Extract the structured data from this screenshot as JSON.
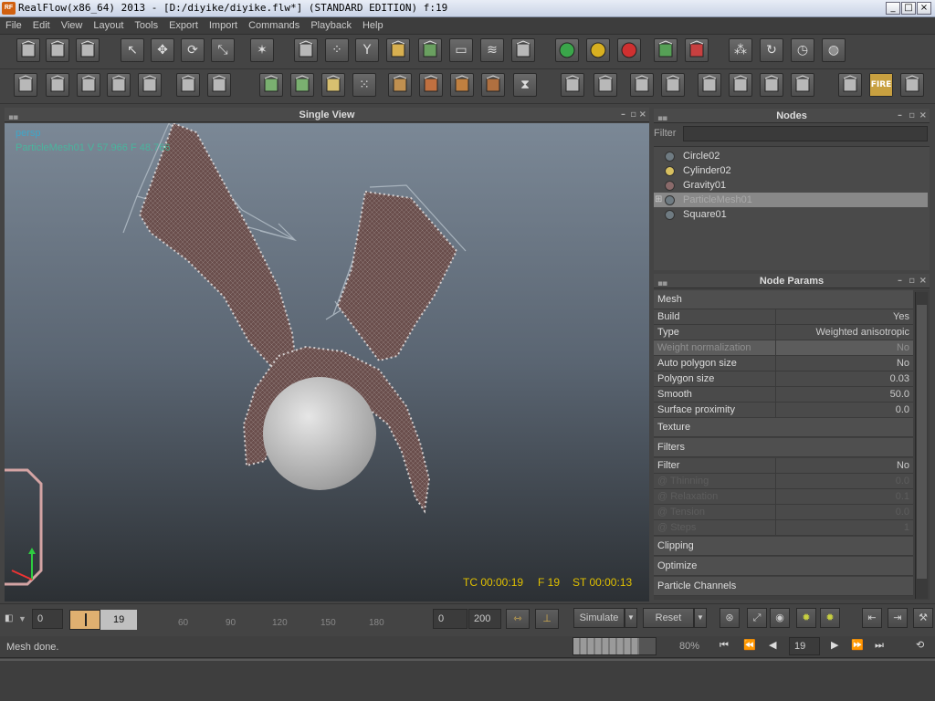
{
  "window": {
    "logo": "RF",
    "title": "RealFlow(x86_64) 2013 - [D:/diyike/diyike.flw*] (STANDARD EDITION) f:19",
    "minimize": "_",
    "maximize": "□",
    "close": "×"
  },
  "menu": [
    "File",
    "Edit",
    "View",
    "Layout",
    "Tools",
    "Export",
    "Import",
    "Commands",
    "Playback",
    "Help"
  ],
  "toolbar1": [
    {
      "icon": "new-file-icon"
    },
    {
      "icon": "open-file-icon"
    },
    {
      "icon": "save-icon"
    },
    {
      "icon": "select-arrow-icon"
    },
    {
      "icon": "move-icon"
    },
    {
      "icon": "rotate-icon"
    },
    {
      "icon": "scale-icon"
    },
    {
      "icon": "axis-icon"
    },
    {
      "icon": "emitter-icon"
    },
    {
      "icon": "particles-icon"
    },
    {
      "icon": "daemon-icon"
    },
    {
      "icon": "object-icon"
    },
    {
      "icon": "mesh-icon"
    },
    {
      "icon": "camera-icon"
    },
    {
      "icon": "wave-icon"
    },
    {
      "icon": "box-icon"
    },
    {
      "icon": "green-dot-icon"
    },
    {
      "icon": "yellow-dot-icon"
    },
    {
      "icon": "red-dot-icon"
    },
    {
      "icon": "save-green-icon"
    },
    {
      "icon": "save-red-icon"
    },
    {
      "icon": "simulate-node-icon"
    },
    {
      "icon": "loop-icon"
    },
    {
      "icon": "clock-icon"
    },
    {
      "icon": "globe-icon"
    }
  ],
  "toolbar2": [
    {
      "icon": "layer-icon"
    },
    {
      "icon": "add-layer-icon"
    },
    {
      "icon": "remove-layer-icon"
    },
    {
      "icon": "link-layer-icon"
    },
    {
      "icon": "export-layer-icon"
    },
    {
      "icon": "cube-open-icon"
    },
    {
      "icon": "cube-icon"
    },
    {
      "icon": "mesh-build-icon"
    },
    {
      "icon": "mesh-wire-icon"
    },
    {
      "icon": "mesh-param-icon"
    },
    {
      "icon": "dots-icon"
    },
    {
      "icon": "render-1-icon"
    },
    {
      "icon": "render-2-icon"
    },
    {
      "icon": "render-3-icon"
    },
    {
      "icon": "render-4-icon"
    },
    {
      "icon": "hourglass-icon"
    },
    {
      "icon": "cube-wire-1-icon"
    },
    {
      "icon": "cube-wire-2-icon"
    },
    {
      "icon": "cube-frame-icon"
    },
    {
      "icon": "cube-frame-2-icon"
    },
    {
      "icon": "view-cube-1-icon"
    },
    {
      "icon": "view-cube-2-icon"
    },
    {
      "icon": "view-cube-3-icon"
    },
    {
      "icon": "view-cube-4-icon"
    },
    {
      "icon": "render-settings-icon"
    },
    {
      "icon": "fire-icon",
      "label": "FIRE"
    },
    {
      "icon": "image-icon"
    }
  ],
  "viewport": {
    "title": "Single View",
    "camera": "persp",
    "overlay": "ParticleMesh01 V 57.966 F 48.766",
    "timecode": "TC 00:00:19",
    "frame": "F 19",
    "sim_time": "ST 00:00:13"
  },
  "nodes": {
    "title": "Nodes",
    "filter_label": "Filter",
    "filter_value": "",
    "items": [
      {
        "name": "Circle02",
        "icon": "circle-node-icon"
      },
      {
        "name": "Cylinder02",
        "icon": "cylinder-node-icon"
      },
      {
        "name": "Gravity01",
        "icon": "gravity-node-icon"
      },
      {
        "name": "ParticleMesh01",
        "icon": "mesh-node-icon",
        "selected": true
      },
      {
        "name": "Square01",
        "icon": "square-node-icon"
      }
    ]
  },
  "params": {
    "title": "Node Params",
    "mesh_section": "Mesh",
    "mesh_rows": [
      {
        "key": "Build",
        "value": "Yes"
      },
      {
        "key": "Type",
        "value": "Weighted anisotropic"
      },
      {
        "key": "Weight normalization",
        "value": "No",
        "highlight": true
      },
      {
        "key": "Auto polygon size",
        "value": "No"
      },
      {
        "key": "Polygon size",
        "value": "0.03"
      },
      {
        "key": "Smooth",
        "value": "50.0"
      },
      {
        "key": "Surface proximity",
        "value": "0.0"
      }
    ],
    "texture_section": "Texture",
    "filters_section": "Filters",
    "filter_rows": [
      {
        "key": "Filter",
        "value": "No"
      },
      {
        "key": "@ Thinning",
        "value": "0.0",
        "disabled": true
      },
      {
        "key": "@ Relaxation",
        "value": "0.1",
        "disabled": true
      },
      {
        "key": "@ Tension",
        "value": "0.0",
        "disabled": true
      },
      {
        "key": "@ Steps",
        "value": "1",
        "disabled": true
      }
    ],
    "bottom_sections": [
      "Clipping",
      "Optimize",
      "Particle Channels"
    ]
  },
  "timeline": {
    "start": "0",
    "current": "19",
    "ticks": [
      "60",
      "90",
      "120",
      "150",
      "180"
    ],
    "range_start": "0",
    "range_end": "200",
    "simulate_label": "Simulate",
    "reset_label": "Reset",
    "current_frame_field": "19"
  },
  "status": {
    "message": "Mesh done.",
    "progress_percent": 80,
    "progress_label": "80%"
  },
  "colors": {
    "mesh": "#6a4e4c",
    "particles": "#c8c0c0",
    "sphere": "#c9c9c9",
    "timecode": "#e0c000",
    "overlay": "#3fc0a0"
  }
}
